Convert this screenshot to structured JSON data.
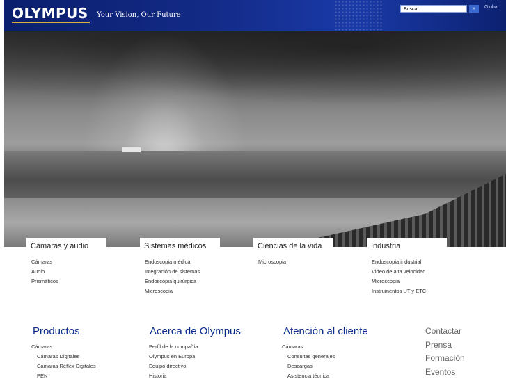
{
  "header": {
    "logo": "OLYMPUS",
    "tagline": "Your Vision, Our Future",
    "search_value": "Buscar",
    "search_button": "»",
    "global_link": "Global"
  },
  "categories": [
    {
      "title": "Cámaras y audio",
      "links": [
        "Cámaras",
        "Audio",
        "Prismáticos"
      ]
    },
    {
      "title": "Sistemas médicos",
      "links": [
        "Endoscopia médica",
        "Integración de sistemas",
        "Endoscopia quirúrgica",
        "Microscopia"
      ]
    },
    {
      "title": "Ciencias de la vida",
      "links": [
        "Microscopia"
      ]
    },
    {
      "title": "Industria",
      "links": [
        "Endoscopia industrial",
        "Video de alta velocidad",
        "Microscopia",
        "Instrumentos UT y ETC"
      ]
    }
  ],
  "footer": {
    "productos": {
      "title": "Productos",
      "links": [
        "Cámaras",
        "Cámaras Digitales",
        "Cámaras Réflex Digitales",
        "PEN"
      ]
    },
    "acerca": {
      "title": "Acerca de Olympus",
      "links": [
        "Perfil de la compañía",
        "Olympus en Europa",
        "Equipo directivo",
        "Historia"
      ]
    },
    "atencion": {
      "title": "Atención al cliente",
      "links": [
        "Cámaras",
        "Consultas generales",
        "Descargas",
        "Asistencia técnica"
      ]
    },
    "side": [
      "Contactar",
      "Prensa",
      "Formación",
      "Eventos"
    ]
  },
  "colors": {
    "header_blue": "#132a86",
    "link_blue": "#0b2c8a",
    "accent_gold": "#d9b23a"
  }
}
